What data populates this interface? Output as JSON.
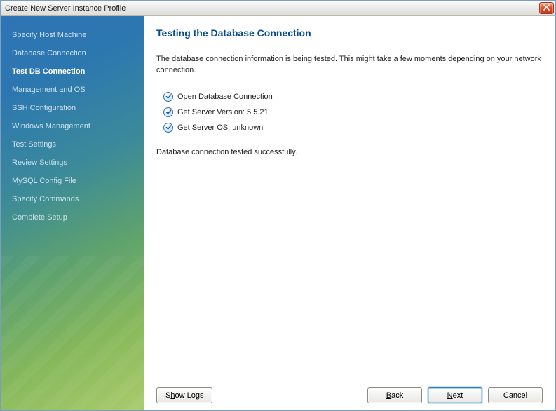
{
  "window": {
    "title": "Create New Server Instance Profile"
  },
  "sidebar": {
    "items": [
      {
        "label": "Specify Host Machine"
      },
      {
        "label": "Database Connection"
      },
      {
        "label": "Test DB Connection",
        "active": true
      },
      {
        "label": "Management and OS"
      },
      {
        "label": "SSH Configuration"
      },
      {
        "label": "Windows Management"
      },
      {
        "label": "Test Settings"
      },
      {
        "label": "Review Settings"
      },
      {
        "label": "MySQL Config File"
      },
      {
        "label": "Specify Commands"
      },
      {
        "label": "Complete Setup"
      }
    ]
  },
  "main": {
    "heading": "Testing the Database Connection",
    "description": "The database connection information is being tested. This might take a few moments depending on your network connection.",
    "checks": [
      {
        "label": "Open Database Connection"
      },
      {
        "label": "Get Server Version: 5.5.21"
      },
      {
        "label": "Get Server OS: unknown"
      }
    ],
    "result": "Database connection tested successfully."
  },
  "footer": {
    "show_logs": {
      "pre": "S",
      "u": "h",
      "post": "ow Logs"
    },
    "back": {
      "pre": "",
      "u": "B",
      "post": "ack"
    },
    "next": {
      "pre": "",
      "u": "N",
      "post": "ext"
    },
    "cancel": {
      "label": "Cancel"
    }
  }
}
